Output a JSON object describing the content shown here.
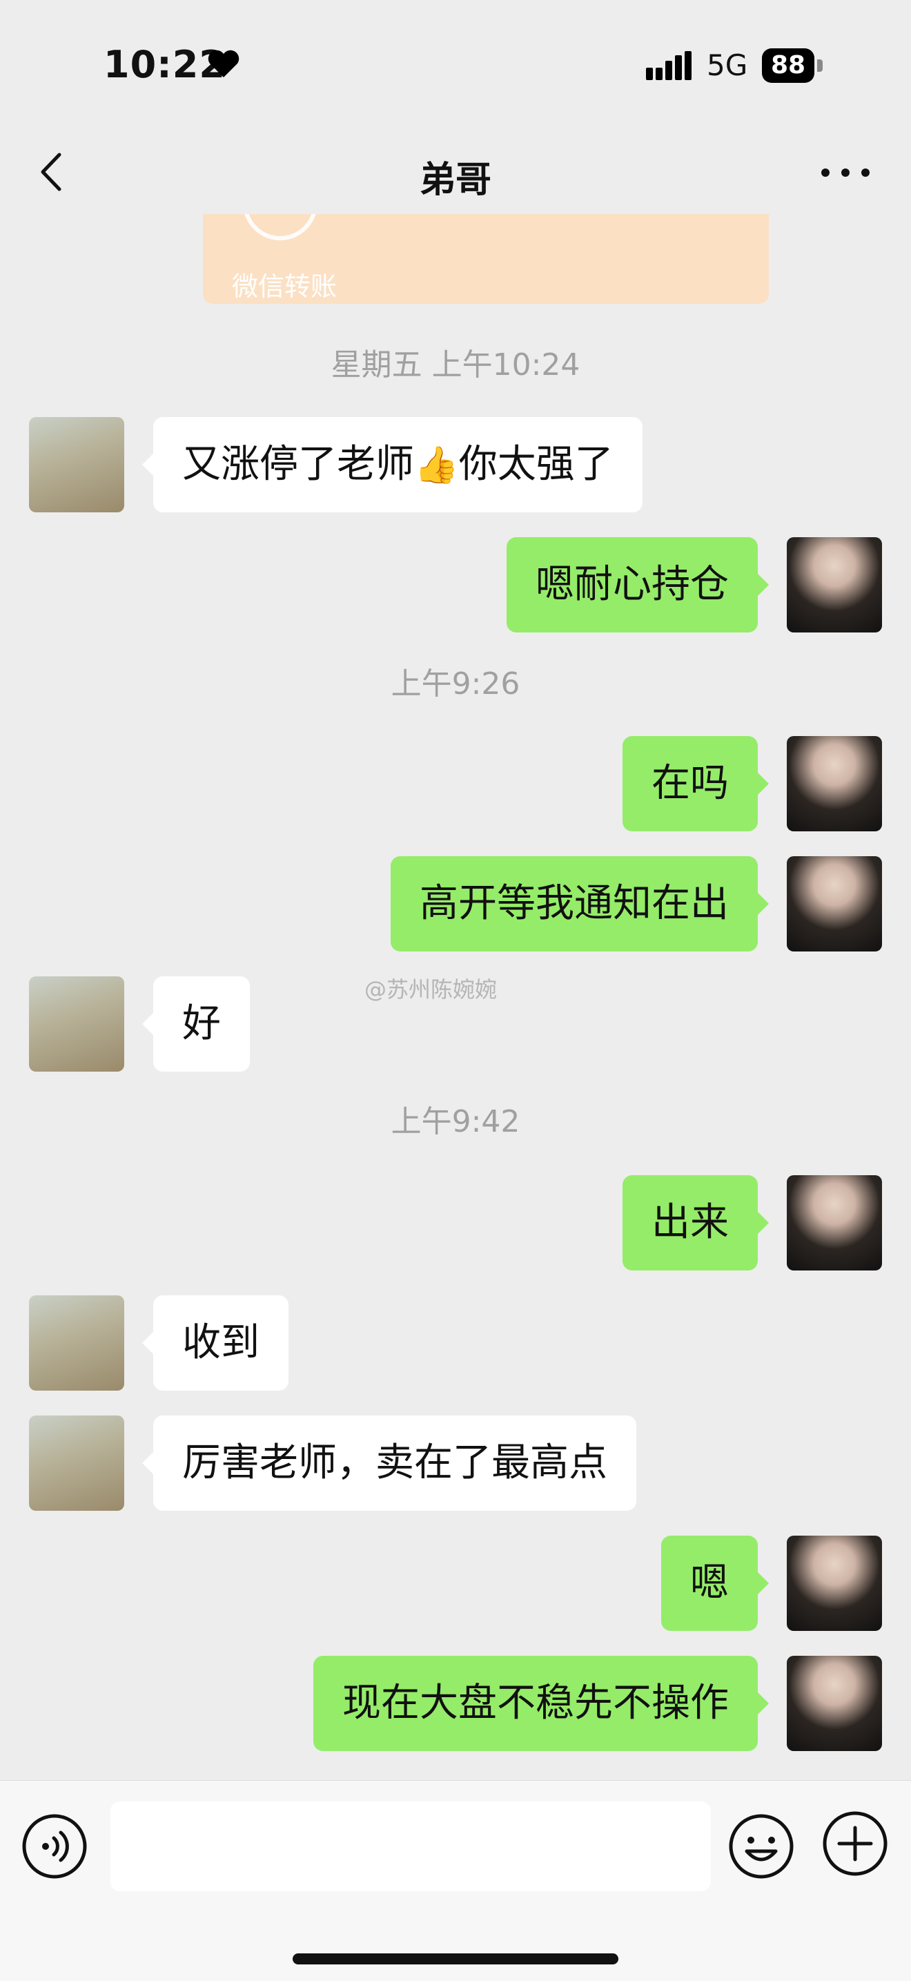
{
  "status": {
    "time": "10:22",
    "network": "5G",
    "battery": "88"
  },
  "chat": {
    "title": "弟哥"
  },
  "transfer": {
    "label": "微信转账"
  },
  "messages": [
    {
      "kind": "time",
      "text": "星期五 上午10:24"
    },
    {
      "kind": "friend",
      "text": "又涨停了老师",
      "emoji": "👍",
      "text_after": "你太强了"
    },
    {
      "kind": "me",
      "text": "嗯耐心持仓"
    },
    {
      "kind": "time",
      "text": "上午9:26"
    },
    {
      "kind": "me",
      "text": "在吗"
    },
    {
      "kind": "me",
      "text": "高开等我通知在出"
    },
    {
      "kind": "friend",
      "text": "好"
    },
    {
      "kind": "time",
      "text": "上午9:42"
    },
    {
      "kind": "me",
      "text": "出来"
    },
    {
      "kind": "friend",
      "text": "收到"
    },
    {
      "kind": "friend",
      "text": "厉害老师，卖在了最高点"
    },
    {
      "kind": "me",
      "text": "嗯"
    },
    {
      "kind": "me",
      "text": "现在大盘不稳先不操作"
    }
  ],
  "watermark": "@苏州陈婉婉",
  "input": {
    "value": "",
    "placeholder": ""
  },
  "icons": {
    "back": "chevron-left-icon",
    "more": "more-dots-icon",
    "voice": "voice-icon",
    "emoji": "emoji-icon",
    "plus": "plus-icon"
  },
  "colors": {
    "my_bubble": "#95ec69",
    "friend_bubble": "#ffffff",
    "background": "#ededed",
    "transfer": "#fbe0c4"
  }
}
